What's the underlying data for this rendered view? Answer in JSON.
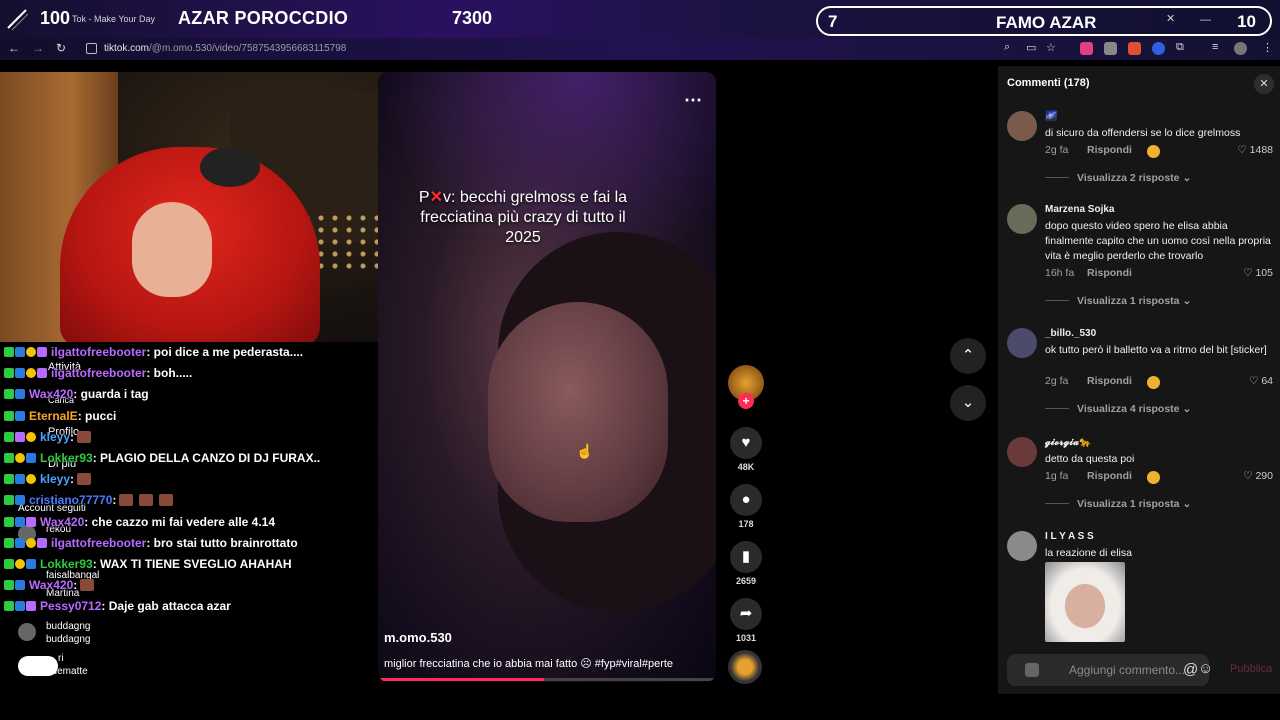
{
  "overlay": {
    "left_number": "100",
    "tab_title": "Tok - Make Your Day",
    "left_title": "AZAR POROCCDIO",
    "mid_number": "7300",
    "pill_number": "7",
    "pill_title": "FAMO AZAR",
    "pill_number_right": "10"
  },
  "browser": {
    "url_host": "tiktok.com",
    "url_path": "/@m.omo.530/video/7587543956683115798"
  },
  "sidebar_ghost": {
    "items": [
      "Attività",
      "Carica",
      "Profilo",
      "Di più",
      "Account seguiti"
    ],
    "accounts": [
      "rekou",
      "faisalbangal",
      "Martina",
      "buddagng",
      "buddagng",
      "ri",
      "ridematte"
    ]
  },
  "chat": [
    {
      "user": "ilgattofreebooter",
      "color": "#b86bff",
      "msg": ": poi dice a me pederasta...."
    },
    {
      "user": "ilgattofreebooter",
      "color": "#b86bff",
      "msg": ": boh....."
    },
    {
      "user": "Wax420",
      "color": "#b86bff",
      "msg": ": guarda i tag"
    },
    {
      "user": "EternalE",
      "color": "#f5a623",
      "msg": ": pucci"
    },
    {
      "user": "kleyy",
      "color": "#4aa3ff",
      "msg": ":"
    },
    {
      "user": "Lokker93",
      "color": "#2ecc40",
      "msg": ": PLAGIO DELLA CANZO DI DJ FURAX.."
    },
    {
      "user": "kleyy",
      "color": "#4aa3ff",
      "msg": ":"
    },
    {
      "user": "cristiano77770",
      "color": "#4a7bff",
      "msg": ":"
    },
    {
      "user": "Wax420",
      "color": "#b86bff",
      "msg": ": che cazzo mi fai vedere alle 4.14"
    },
    {
      "user": "ilgattofreebooter",
      "color": "#b86bff",
      "msg": ": bro stai tutto brainrottato"
    },
    {
      "user": "Lokker93",
      "color": "#2ecc40",
      "msg": ": WAX TI TIENE SVEGLIO AHAHAH"
    },
    {
      "user": "Wax420",
      "color": "#b86bff",
      "msg": ":"
    },
    {
      "user": "Pessy0712",
      "color": "#b86bff",
      "msg": ": Daje gab attacca azar"
    }
  ],
  "video": {
    "caption_prefix": "P",
    "caption_cross": "✕",
    "caption_rest": "v: becchi grelmoss e fai la frecciatina più crazy di tutto il 2025",
    "author": "m.omo.530",
    "description": "miglior frecciatina che io abbia mai fatto ☹ #fyp#viral#perte",
    "progress": 0.49
  },
  "rail": {
    "likes": "48K",
    "comments": "178",
    "saves": "2659",
    "shares": "1031"
  },
  "comments": {
    "title": "Commenti (178)",
    "input_placeholder": "Aggiungi commento...",
    "publish_label": "Pubblica",
    "items": [
      {
        "user": "🌌",
        "text": "di sicuro da offendersi se lo dice grelmoss",
        "time": "2g fa",
        "reply": "Rispondi",
        "likes": "1488",
        "view": "Visualizza 2 risposte",
        "avatar": "#7a5a4a"
      },
      {
        "user": "Marzena Sojka",
        "text": "dopo questo video spero he elisa abbia finalmente capito che un uomo così nella propria vita è meglio perderlo che trovarlo",
        "time": "16h fa",
        "reply": "Rispondi",
        "likes": "105",
        "view": "Visualizza 1 risposta",
        "avatar": "#6a6a5a"
      },
      {
        "user": "_billo._530",
        "text": "ok tutto però il balletto va a ritmo del bit [sticker]",
        "time": "2g fa",
        "reply": "Rispondi",
        "likes": "64",
        "view": "Visualizza 4 risposte",
        "avatar": "#4a4a6a"
      },
      {
        "user": "𝓰𝓲𝓸𝓻𝓰𝓲𝓪🐆",
        "text": "detto da questa poi",
        "time": "1g fa",
        "reply": "Rispondi",
        "likes": "290",
        "view": "Visualizza 1 risposta",
        "avatar": "#6a3a3a"
      },
      {
        "user": "I L Y A S S",
        "text": "la reazione di elisa",
        "avatar": "#8a8a8a"
      }
    ]
  }
}
